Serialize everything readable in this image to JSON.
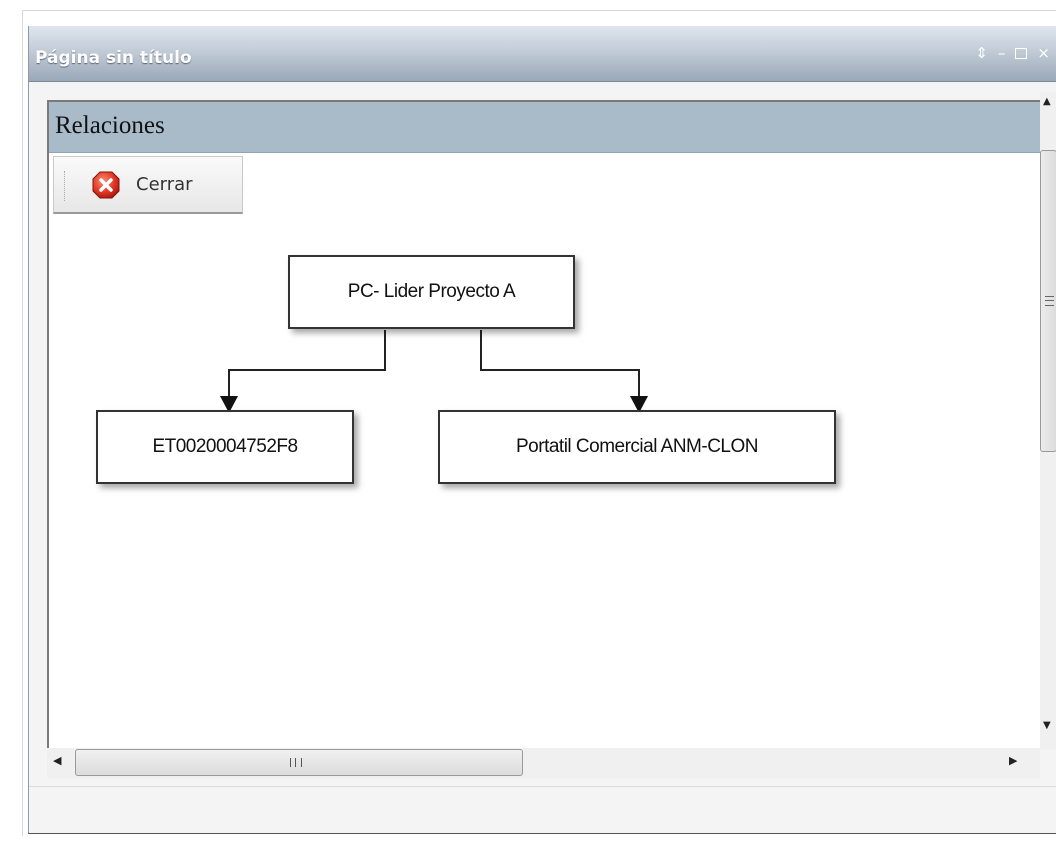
{
  "window": {
    "title": "Página sin título",
    "controls": [
      "restore-icon",
      "minimize-icon",
      "maximize-icon",
      "close-icon"
    ]
  },
  "panel": {
    "title": "Relaciones"
  },
  "toolbar": {
    "close_label": "Cerrar",
    "close_icon": "close-circle-icon"
  },
  "diagram": {
    "root": "PC- Lider Proyecto A",
    "children": [
      "ET0020004752F8",
      "Portatil Comercial ANM-CLON"
    ]
  },
  "colors": {
    "panel_header": "#a9bac9",
    "close_icon_red": "#e03a2a"
  }
}
